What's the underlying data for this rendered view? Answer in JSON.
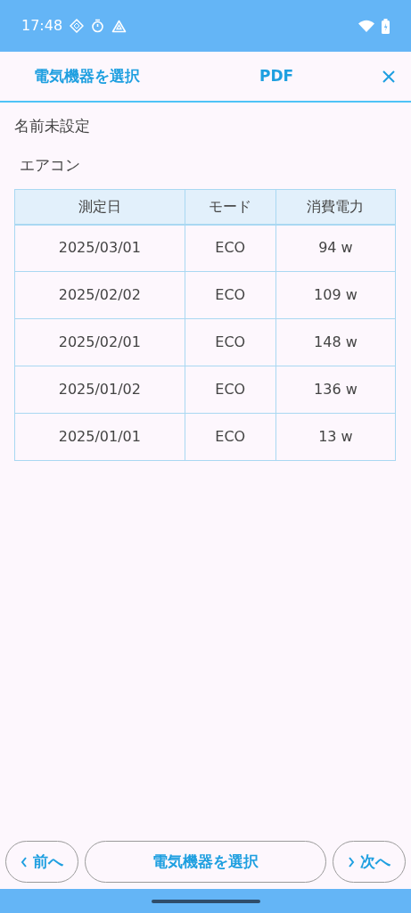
{
  "status_bar": {
    "time": "17:48"
  },
  "header": {
    "back_label": "電気機器を選択",
    "pdf_label": "PDF"
  },
  "owner": "名前未設定",
  "device": "エアコン",
  "table": {
    "columns": [
      "測定日",
      "モード",
      "消費電力"
    ],
    "rows": [
      [
        "2025/03/01",
        "ECO",
        "94 w"
      ],
      [
        "2025/02/02",
        "ECO",
        "109 w"
      ],
      [
        "2025/02/01",
        "ECO",
        "148 w"
      ],
      [
        "2025/01/02",
        "ECO",
        "136 w"
      ],
      [
        "2025/01/01",
        "ECO",
        "13 w"
      ]
    ]
  },
  "footer": {
    "prev_label": "前へ",
    "select_label": "電気機器を選択",
    "next_label": "次へ"
  }
}
